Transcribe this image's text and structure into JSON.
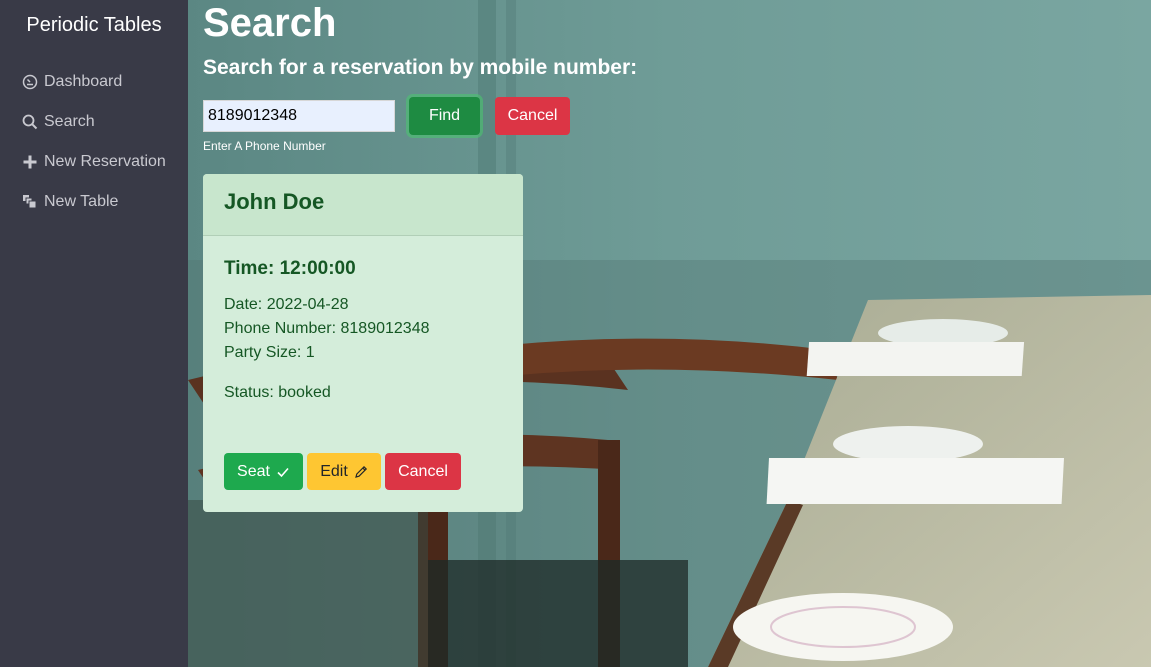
{
  "sidebar": {
    "brand": "Periodic Tables",
    "items": [
      {
        "label": "Dashboard",
        "icon": "dashboard-icon"
      },
      {
        "label": "Search",
        "icon": "search-icon"
      },
      {
        "label": "New Reservation",
        "icon": "plus-icon"
      },
      {
        "label": "New Table",
        "icon": "layers-icon"
      }
    ]
  },
  "main": {
    "title": "Search",
    "subtitle": "Search for a reservation by mobile number:",
    "search": {
      "value": "8189012348",
      "help_text": "Enter A Phone Number",
      "find_label": "Find",
      "cancel_label": "Cancel"
    },
    "reservation": {
      "name": "John Doe",
      "time": "Time: 12:00:00",
      "date": "Date: 2022-04-28",
      "phone": "Phone Number: 8189012348",
      "party_size": "Party Size: 1",
      "status": "Status: booked",
      "seat_label": "Seat",
      "edit_label": "Edit",
      "cancel_label": "Cancel"
    }
  },
  "colors": {
    "sidebar_bg": "#393a47",
    "find_button": "#1e8b42",
    "cancel_button": "#dc3545",
    "seat_button": "#1ea94e",
    "edit_button": "#fec632",
    "card_bg": "#d4edda",
    "card_text": "#155724"
  }
}
